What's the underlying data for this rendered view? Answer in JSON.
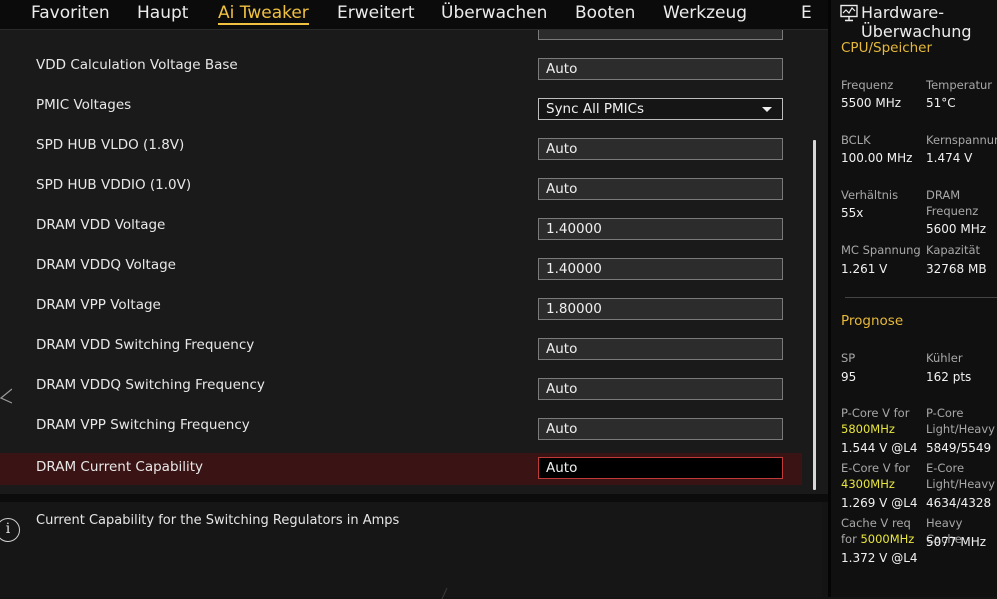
{
  "nav": {
    "tabs": [
      "Favoriten",
      "Haupt",
      "Ai Tweaker",
      "Erweitert",
      "Überwachen",
      "Booten",
      "Werkzeug",
      "E"
    ],
    "active": "Ai Tweaker"
  },
  "settings": [
    {
      "label": "VDD Calculation Voltage Base",
      "value": "Auto"
    },
    {
      "label": "PMIC Voltages",
      "value": "Sync All PMICs",
      "type": "select"
    },
    {
      "label": "SPD HUB VLDO (1.8V)",
      "value": "Auto"
    },
    {
      "label": "SPD HUB VDDIO (1.0V)",
      "value": "Auto"
    },
    {
      "label": "DRAM VDD Voltage",
      "value": "1.40000"
    },
    {
      "label": "DRAM VDDQ Voltage",
      "value": "1.40000"
    },
    {
      "label": "DRAM VPP Voltage",
      "value": "1.80000"
    },
    {
      "label": "DRAM VDD Switching Frequency",
      "value": "Auto"
    },
    {
      "label": "DRAM VDDQ Switching Frequency",
      "value": "Auto"
    },
    {
      "label": "DRAM VPP Switching Frequency",
      "value": "Auto"
    },
    {
      "label": "DRAM Current Capability",
      "value": "Auto",
      "selected": true
    }
  ],
  "help": {
    "text": "Current Capability for the Switching Regulators in Amps",
    "icon": "info-icon"
  },
  "hwmon": {
    "title": "Hardware-Überwac­hung",
    "icon": "monitor-icon",
    "cpu_section": "CPU/Speicher",
    "cpu": [
      {
        "label": "Frequenz",
        "value": "5500 MHz"
      },
      {
        "label": "Temperatur",
        "value": "51°C"
      },
      {
        "label": "BCLK",
        "value": "100.00 MHz"
      },
      {
        "label": "Kernspannung",
        "value": "1.474 V"
      },
      {
        "label": "Verhältnis",
        "value": "55x"
      },
      {
        "label": "DRAM Frequenz",
        "value": "5600 MHz"
      },
      {
        "label": "MC Spannung",
        "value": "1.261 V"
      },
      {
        "label": "Kapazität",
        "value": "32768 MB"
      }
    ],
    "forecast_section": "Prognose",
    "sp_label": "SP",
    "sp_value": "95",
    "cooler_label": "Kühler",
    "cooler_value": "162 pts",
    "pcore_label": "P-Core V for",
    "pcore_freq": "5800MHz",
    "pcore_value": "1.544 V @L4",
    "pcore_lh_label": "P-Core Light/Heavy",
    "pcore_lh_value": "5849/5549",
    "ecore_label": "E-Core V for",
    "ecore_freq": "4300MHz",
    "ecore_value": "1.269 V @L4",
    "ecore_lh_label": "E-Core Light/Heavy",
    "ecore_lh_value": "4634/4328",
    "cache_label": "Cache V req for",
    "cache_freq": "5000MHz",
    "cache_value": "1.372 V @L4",
    "heavy_cache_label": "Heavy Cache",
    "heavy_cache_value": "5077 MHz"
  },
  "colors": {
    "accent": "#f0c040",
    "selected_row": "#3a1314",
    "highlight": "#e9e63c"
  }
}
